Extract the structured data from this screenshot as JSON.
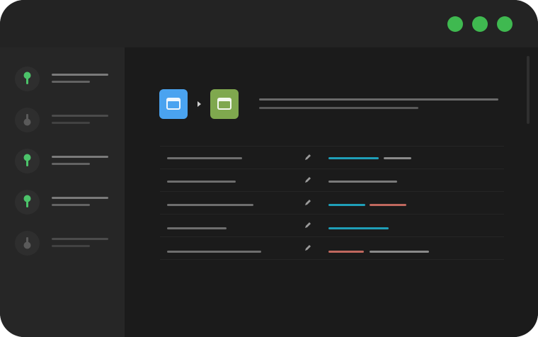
{
  "window": {
    "controls": [
      {
        "name": "window-dot-1",
        "color": "#3fb950"
      },
      {
        "name": "window-dot-2",
        "color": "#3fb950"
      },
      {
        "name": "window-dot-3",
        "color": "#3fb950"
      }
    ]
  },
  "sidebar": {
    "items": [
      {
        "status": "active",
        "icon": "branch-pin-icon",
        "color": "#4cc36a"
      },
      {
        "status": "inactive",
        "icon": "branch-pin-icon",
        "color": "#5a5a5a"
      },
      {
        "status": "active",
        "icon": "branch-pin-icon",
        "color": "#4cc36a"
      },
      {
        "status": "active",
        "icon": "branch-pin-icon",
        "color": "#4cc36a"
      },
      {
        "status": "inactive",
        "icon": "branch-pin-icon",
        "color": "#5a5a5a"
      }
    ]
  },
  "header": {
    "source_icon": {
      "icon": "window-icon",
      "color": "#4aa3f0"
    },
    "target_icon": {
      "icon": "window-icon",
      "color": "#7fa84e"
    },
    "arrow_icon": "chevron-right-icon"
  },
  "table": {
    "edit_icon": "pencil-icon",
    "tag_colors": {
      "teal": "#1f9fb8",
      "red": "#c0685e",
      "gray": "#8a8a8a"
    },
    "rows": [
      {
        "tags": [
          "teal",
          "gray"
        ]
      },
      {
        "tags": [
          "gray"
        ]
      },
      {
        "tags": [
          "teal",
          "red"
        ]
      },
      {
        "tags": [
          "teal"
        ]
      },
      {
        "tags": [
          "red",
          "gray"
        ]
      }
    ]
  }
}
